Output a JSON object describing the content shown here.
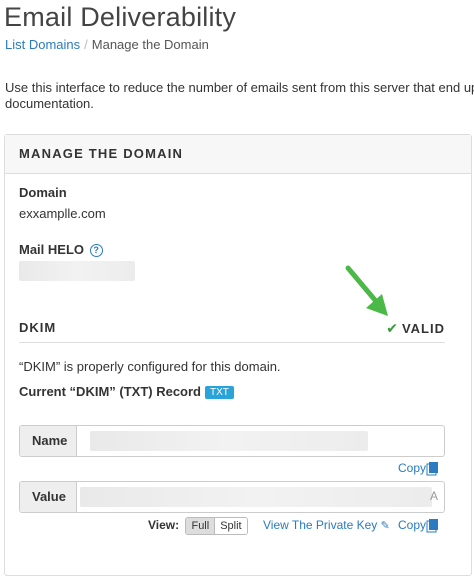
{
  "page": {
    "title": "Email Deliverability",
    "breadcrumb": {
      "parent": "List Domains",
      "current": "Manage the Domain"
    },
    "intro_line1": "Use this interface to reduce the number of emails sent from this server that end up",
    "intro_line2": "documentation."
  },
  "panel": {
    "heading": "MANAGE THE DOMAIN",
    "domain_label": "Domain",
    "domain_value": "exxamplle.com",
    "helo_label": "Mail HELO",
    "help_icon": "question-circle-icon",
    "dkim": {
      "title": "DKIM",
      "status": "VALID",
      "status_icon": "check-icon",
      "status_color": "#3a9a3a",
      "message": "“DKIM” is properly configured for this domain.",
      "record_label": "Current “DKIM” (TXT) Record",
      "record_badge": "TXT",
      "name_label": "Name",
      "value_label": "Value",
      "value_tail": "A",
      "copy_label": "Copy",
      "view_label": "View:",
      "view_options": [
        "Full",
        "Split"
      ],
      "view_selected": "Full",
      "private_key_label": "View The Private Key"
    }
  },
  "colors": {
    "link": "#2a7bbf",
    "badge": "#2aa3d8",
    "annotation_arrow": "#4cb847"
  }
}
